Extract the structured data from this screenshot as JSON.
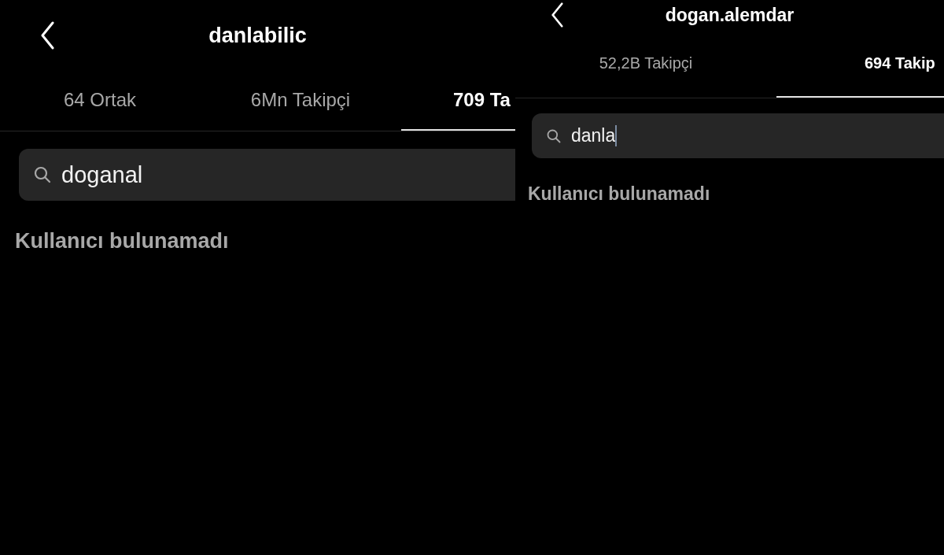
{
  "panels": [
    {
      "title": "danlabilic",
      "tabs": [
        {
          "label": "64 Ortak",
          "selected": false
        },
        {
          "label": "6Mn Takipçi",
          "selected": false
        },
        {
          "label": "709 Ta",
          "selected": true
        }
      ],
      "search": {
        "value": "doganal",
        "focused": false
      },
      "message": "Kullanıcı bulunamadı"
    },
    {
      "title": "dogan.alemdar",
      "tabs": [
        {
          "label": "52,2B Takipçi",
          "selected": false
        },
        {
          "label": "694 Takip",
          "selected": true
        }
      ],
      "search": {
        "value": "danla",
        "focused": true
      },
      "message": "Kullanıcı bulunamadı"
    }
  ]
}
